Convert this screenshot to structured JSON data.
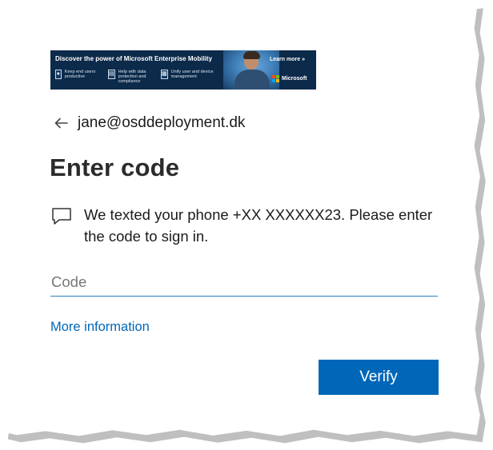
{
  "banner": {
    "headline": "Discover the power of Microsoft Enterprise Mobility",
    "features": [
      {
        "icon": "user-icon",
        "text": "Keep end users productive"
      },
      {
        "icon": "document-icon",
        "text": "Help with data protection and compliance"
      },
      {
        "icon": "device-icon",
        "text": "Unify user and device management"
      }
    ],
    "learn_more": "Learn more »",
    "brand": "Microsoft",
    "brand_colors": [
      "#f25022",
      "#7fba00",
      "#00a4ef",
      "#ffb900"
    ]
  },
  "identity": {
    "email": "jane@osddeployment.dk"
  },
  "page": {
    "title": "Enter code",
    "message": "We texted your phone +XX XXXXXX23. Please enter the code to sign in."
  },
  "form": {
    "code_placeholder": "Code",
    "code_value": "",
    "more_info_link": "More information",
    "verify_label": "Verify"
  },
  "colors": {
    "accent": "#0067b8",
    "input_underline": "#2a7fc4"
  }
}
